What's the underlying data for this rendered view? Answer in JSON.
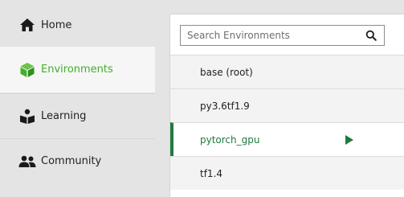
{
  "sidebar": {
    "items": [
      {
        "label": "Home",
        "icon": "home-icon",
        "active": false
      },
      {
        "label": "Environments",
        "icon": "cube-icon",
        "active": true
      },
      {
        "label": "Learning",
        "icon": "book-reader-icon",
        "active": false
      },
      {
        "label": "Community",
        "icon": "people-icon",
        "active": false
      }
    ]
  },
  "environments": {
    "search": {
      "placeholder": "Search Environments",
      "value": ""
    },
    "items": [
      {
        "name": "base (root)",
        "selected": false
      },
      {
        "name": "py3.6tf1.9",
        "selected": false
      },
      {
        "name": "pytorch_gpu",
        "selected": true
      },
      {
        "name": "tf1.4",
        "selected": false
      }
    ]
  },
  "colors": {
    "accent_green": "#43b02a",
    "selected_green": "#1f7a3e",
    "sidebar_bg": "#e4e4e4",
    "active_bg": "#f6f6f6"
  }
}
